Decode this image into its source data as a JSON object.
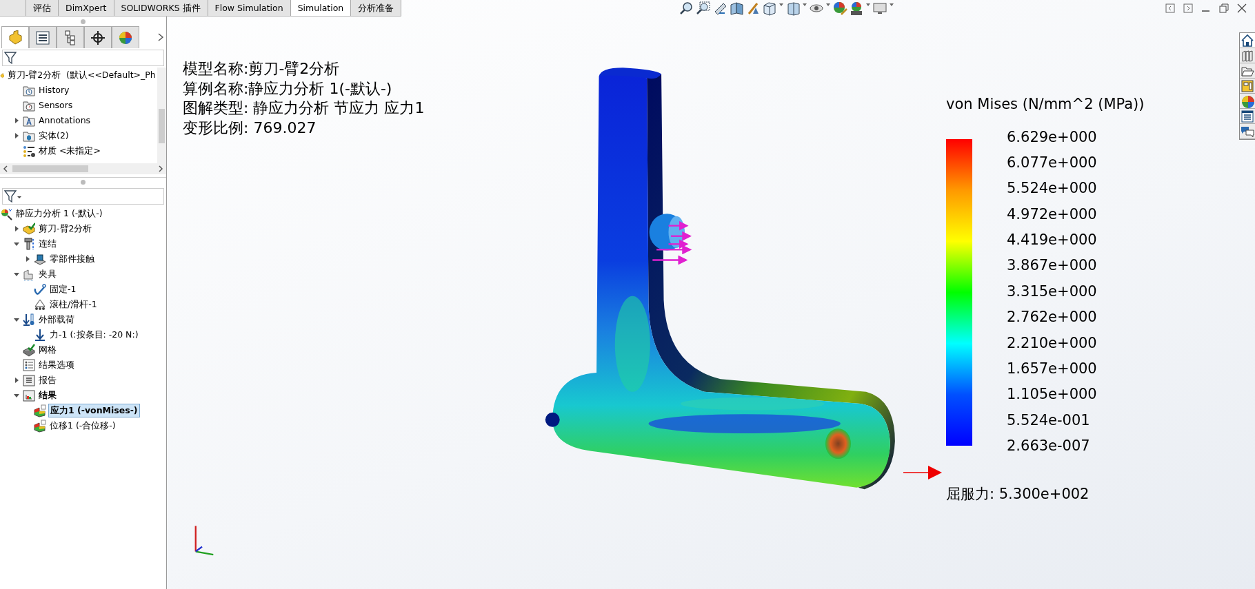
{
  "command_tabs": [
    {
      "label": "评估",
      "selected": false
    },
    {
      "label": "DimXpert",
      "selected": false
    },
    {
      "label": "SOLIDWORKS 插件",
      "selected": false
    },
    {
      "label": "Flow Simulation",
      "selected": false
    },
    {
      "label": "Simulation",
      "selected": true
    },
    {
      "label": "分析准备",
      "selected": false
    }
  ],
  "manager_tabs": [
    {
      "kind": "feature",
      "selected": true
    },
    {
      "kind": "property",
      "selected": false
    },
    {
      "kind": "config",
      "selected": false
    },
    {
      "kind": "dimxpert",
      "selected": false
    },
    {
      "kind": "display",
      "selected": false
    }
  ],
  "feature_tree": [
    {
      "label": "剪刀-臂2分析  (默认<<Default>_Ph",
      "kind": "part",
      "selected": false,
      "active": false,
      "children": [
        {
          "label": "History",
          "kind": "history",
          "selected": false,
          "active": false
        },
        {
          "label": "Sensors",
          "kind": "sensors",
          "selected": false,
          "active": false
        },
        {
          "label": "Annotations",
          "kind": "annotations",
          "expanded": false,
          "selected": false,
          "active": false
        },
        {
          "label": "实体(2)",
          "kind": "bodies",
          "expanded": false,
          "selected": false,
          "active": false
        },
        {
          "label": "材质 <未指定>",
          "kind": "material",
          "selected": false,
          "active": false
        }
      ]
    }
  ],
  "study_tree": [
    {
      "label": "静应力分析 1 (-默认-)",
      "kind": "study",
      "selected": false,
      "active": false,
      "children": [
        {
          "label": "剪刀-臂2分析",
          "kind": "part_check",
          "expanded": false,
          "selected": false,
          "active": false
        },
        {
          "label": "连结",
          "kind": "connections",
          "expanded": true,
          "selected": false,
          "active": false,
          "children": [
            {
              "label": "零部件接触",
              "kind": "contact",
              "expanded": false,
              "selected": false,
              "active": false
            }
          ]
        },
        {
          "label": "夹具",
          "kind": "fixtures",
          "expanded": true,
          "selected": false,
          "active": false,
          "children": [
            {
              "label": "固定-1",
              "kind": "fixed",
              "selected": false,
              "active": false
            },
            {
              "label": "滚柱/滑杆-1",
              "kind": "roller",
              "selected": false,
              "active": false
            }
          ]
        },
        {
          "label": "外部载荷",
          "kind": "loads",
          "expanded": true,
          "selected": false,
          "active": false,
          "children": [
            {
              "label": "力-1 (:按条目: -20 N:)",
              "kind": "force",
              "selected": false,
              "active": false
            }
          ]
        },
        {
          "label": "网格",
          "kind": "mesh",
          "selected": false,
          "active": false
        },
        {
          "label": "结果选项",
          "kind": "options",
          "selected": false,
          "active": false
        },
        {
          "label": "报告",
          "kind": "report",
          "expanded": false,
          "selected": false,
          "active": false
        },
        {
          "label": "结果",
          "kind": "results",
          "expanded": true,
          "selected": false,
          "active": true,
          "children": [
            {
              "label": "应力1 (-vonMises-)",
              "kind": "plot",
              "selected": true,
              "active": true
            },
            {
              "label": "位移1 (-合位移-)",
              "kind": "plot",
              "selected": false,
              "active": false
            }
          ]
        }
      ]
    }
  ],
  "plot_info": [
    "模型名称:剪刀-臂2分析",
    "算例名称:静应力分析 1(-默认-)",
    "图解类型: 静应力分析 节应力 应力1",
    "变形比例: 769.027"
  ],
  "legend": {
    "title": "von Mises (N/mm^2 (MPa))",
    "labels": [
      "6.629e+000",
      "6.077e+000",
      "5.524e+000",
      "4.972e+000",
      "4.419e+000",
      "3.867e+000",
      "3.315e+000",
      "2.762e+000",
      "2.210e+000",
      "1.657e+000",
      "1.105e+000",
      "5.524e-001",
      "2.663e-007"
    ],
    "yield_label": "屈服力: 5.300e+002"
  }
}
